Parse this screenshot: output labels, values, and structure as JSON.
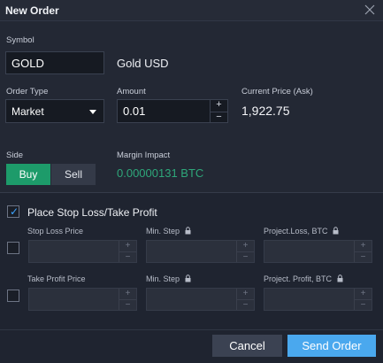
{
  "window": {
    "title": "New Order",
    "close_icon": "close-icon"
  },
  "symbol": {
    "label": "Symbol",
    "value": "GOLD",
    "name": "Gold USD"
  },
  "order_type": {
    "label": "Order Type",
    "value": "Market"
  },
  "amount": {
    "label": "Amount",
    "value": "0.01",
    "plus": "+",
    "minus": "−"
  },
  "current_price": {
    "label": "Current Price (Ask)",
    "value": "1,922.75"
  },
  "side": {
    "label": "Side",
    "buy": "Buy",
    "sell": "Sell",
    "selected": "Buy"
  },
  "margin": {
    "label": "Margin Impact",
    "value": "0.00000131 BTC"
  },
  "stop_loss_take_profit": {
    "checkbox_label": "Place Stop Loss/Take Profit",
    "checked": true,
    "stop_loss": {
      "price_label": "Stop Loss Price",
      "step_label": "Min. Step",
      "projected_label": "Project.Loss, BTC"
    },
    "take_profit": {
      "price_label": "Take Profit Price",
      "step_label": "Min. Step",
      "projected_label": "Project. Profit, BTC"
    }
  },
  "footer": {
    "cancel": "Cancel",
    "send": "Send Order"
  },
  "colors": {
    "background": "#1f2430",
    "buy": "#1d9b6a",
    "send": "#4aa8ee",
    "margin_value": "#2ea77a",
    "checkbox_accent": "#3ea3ff"
  }
}
